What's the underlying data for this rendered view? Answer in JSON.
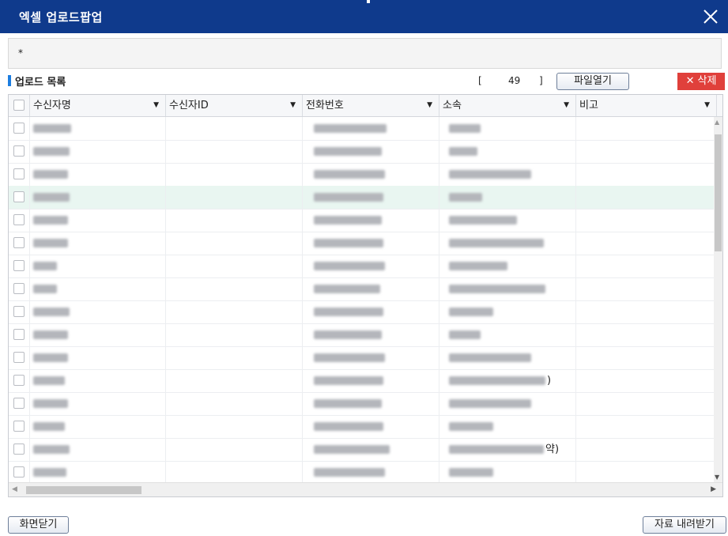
{
  "dialog": {
    "title": "엑셀 업로드팝업"
  },
  "info": {
    "note": "*"
  },
  "section": {
    "title": "업로드 목록"
  },
  "count": {
    "open_bracket": "[",
    "value": "49",
    "close_bracket": "]"
  },
  "buttons": {
    "open_file": "파일열기",
    "delete": "삭제",
    "close": "화면닫기",
    "download": "자료 내려받기"
  },
  "table": {
    "columns": [
      "수신자명",
      "수신자ID",
      "전화번호",
      "소속",
      "비고"
    ],
    "highlighted_row": 3,
    "rows": [
      {
        "name_w": 48,
        "phone_w": 92,
        "org_w": 40,
        "suffix": ""
      },
      {
        "name_w": 46,
        "phone_w": 86,
        "org_w": 36,
        "suffix": ""
      },
      {
        "name_w": 44,
        "phone_w": 90,
        "org_w": 104,
        "suffix": ""
      },
      {
        "name_w": 46,
        "phone_w": 88,
        "org_w": 42,
        "suffix": ""
      },
      {
        "name_w": 44,
        "phone_w": 86,
        "org_w": 86,
        "suffix": ""
      },
      {
        "name_w": 44,
        "phone_w": 88,
        "org_w": 120,
        "suffix": ""
      },
      {
        "name_w": 30,
        "phone_w": 90,
        "org_w": 74,
        "suffix": ""
      },
      {
        "name_w": 30,
        "phone_w": 84,
        "org_w": 122,
        "suffix": ""
      },
      {
        "name_w": 46,
        "phone_w": 88,
        "org_w": 56,
        "suffix": ""
      },
      {
        "name_w": 44,
        "phone_w": 86,
        "org_w": 40,
        "suffix": ""
      },
      {
        "name_w": 44,
        "phone_w": 90,
        "org_w": 104,
        "suffix": ""
      },
      {
        "name_w": 40,
        "phone_w": 88,
        "org_w": 122,
        "suffix": ")"
      },
      {
        "name_w": 44,
        "phone_w": 86,
        "org_w": 104,
        "suffix": ""
      },
      {
        "name_w": 40,
        "phone_w": 88,
        "org_w": 56,
        "suffix": ""
      },
      {
        "name_w": 46,
        "phone_w": 96,
        "org_w": 120,
        "suffix": "약)"
      },
      {
        "name_w": 42,
        "phone_w": 90,
        "org_w": 56,
        "suffix": ""
      },
      {
        "name_w": 42,
        "phone_w": 88,
        "org_w": 88,
        "suffix": ""
      }
    ]
  }
}
